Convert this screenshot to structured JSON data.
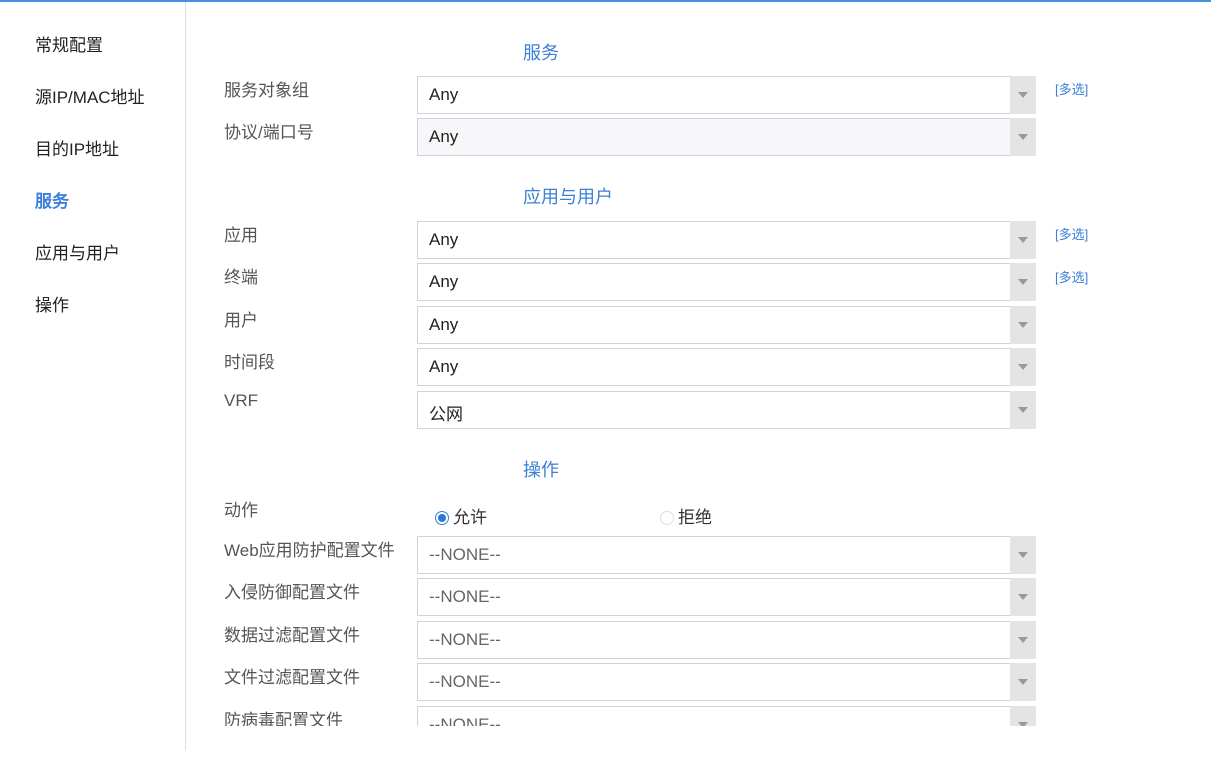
{
  "sidebar": {
    "items": [
      {
        "label": "常规配置"
      },
      {
        "label": "源IP/MAC地址"
      },
      {
        "label": "目的IP地址"
      },
      {
        "label": "服务",
        "active": true
      },
      {
        "label": "应用与用户"
      },
      {
        "label": "操作"
      }
    ]
  },
  "sections": {
    "service": "服务",
    "app_user": "应用与用户",
    "action": "操作"
  },
  "multi_label": "[多选]",
  "fields": {
    "service_group": {
      "label": "服务对象组",
      "value": "Any"
    },
    "protocol_port": {
      "label": "协议/端口号",
      "value": "Any"
    },
    "application": {
      "label": "应用",
      "value": "Any"
    },
    "terminal": {
      "label": "终端",
      "value": "Any"
    },
    "user": {
      "label": "用户",
      "value": "Any"
    },
    "time_range": {
      "label": "时间段",
      "value": "Any"
    },
    "vrf": {
      "label": "VRF",
      "value": "公网"
    },
    "action": {
      "label": "动作",
      "options": [
        "允许",
        "拒绝"
      ],
      "selected": "允许"
    },
    "waf_profile": {
      "label": "Web应用防护配置文件",
      "value": "--NONE--"
    },
    "ips_profile": {
      "label": "入侵防御配置文件",
      "value": "--NONE--"
    },
    "data_filter_profile": {
      "label": "数据过滤配置文件",
      "value": "--NONE--"
    },
    "file_filter_profile": {
      "label": "文件过滤配置文件",
      "value": "--NONE--"
    },
    "antivirus_profile": {
      "label": "防病毒配置文件",
      "value": "--NONE--"
    }
  },
  "colors": {
    "accent": "#3b7fd6"
  }
}
